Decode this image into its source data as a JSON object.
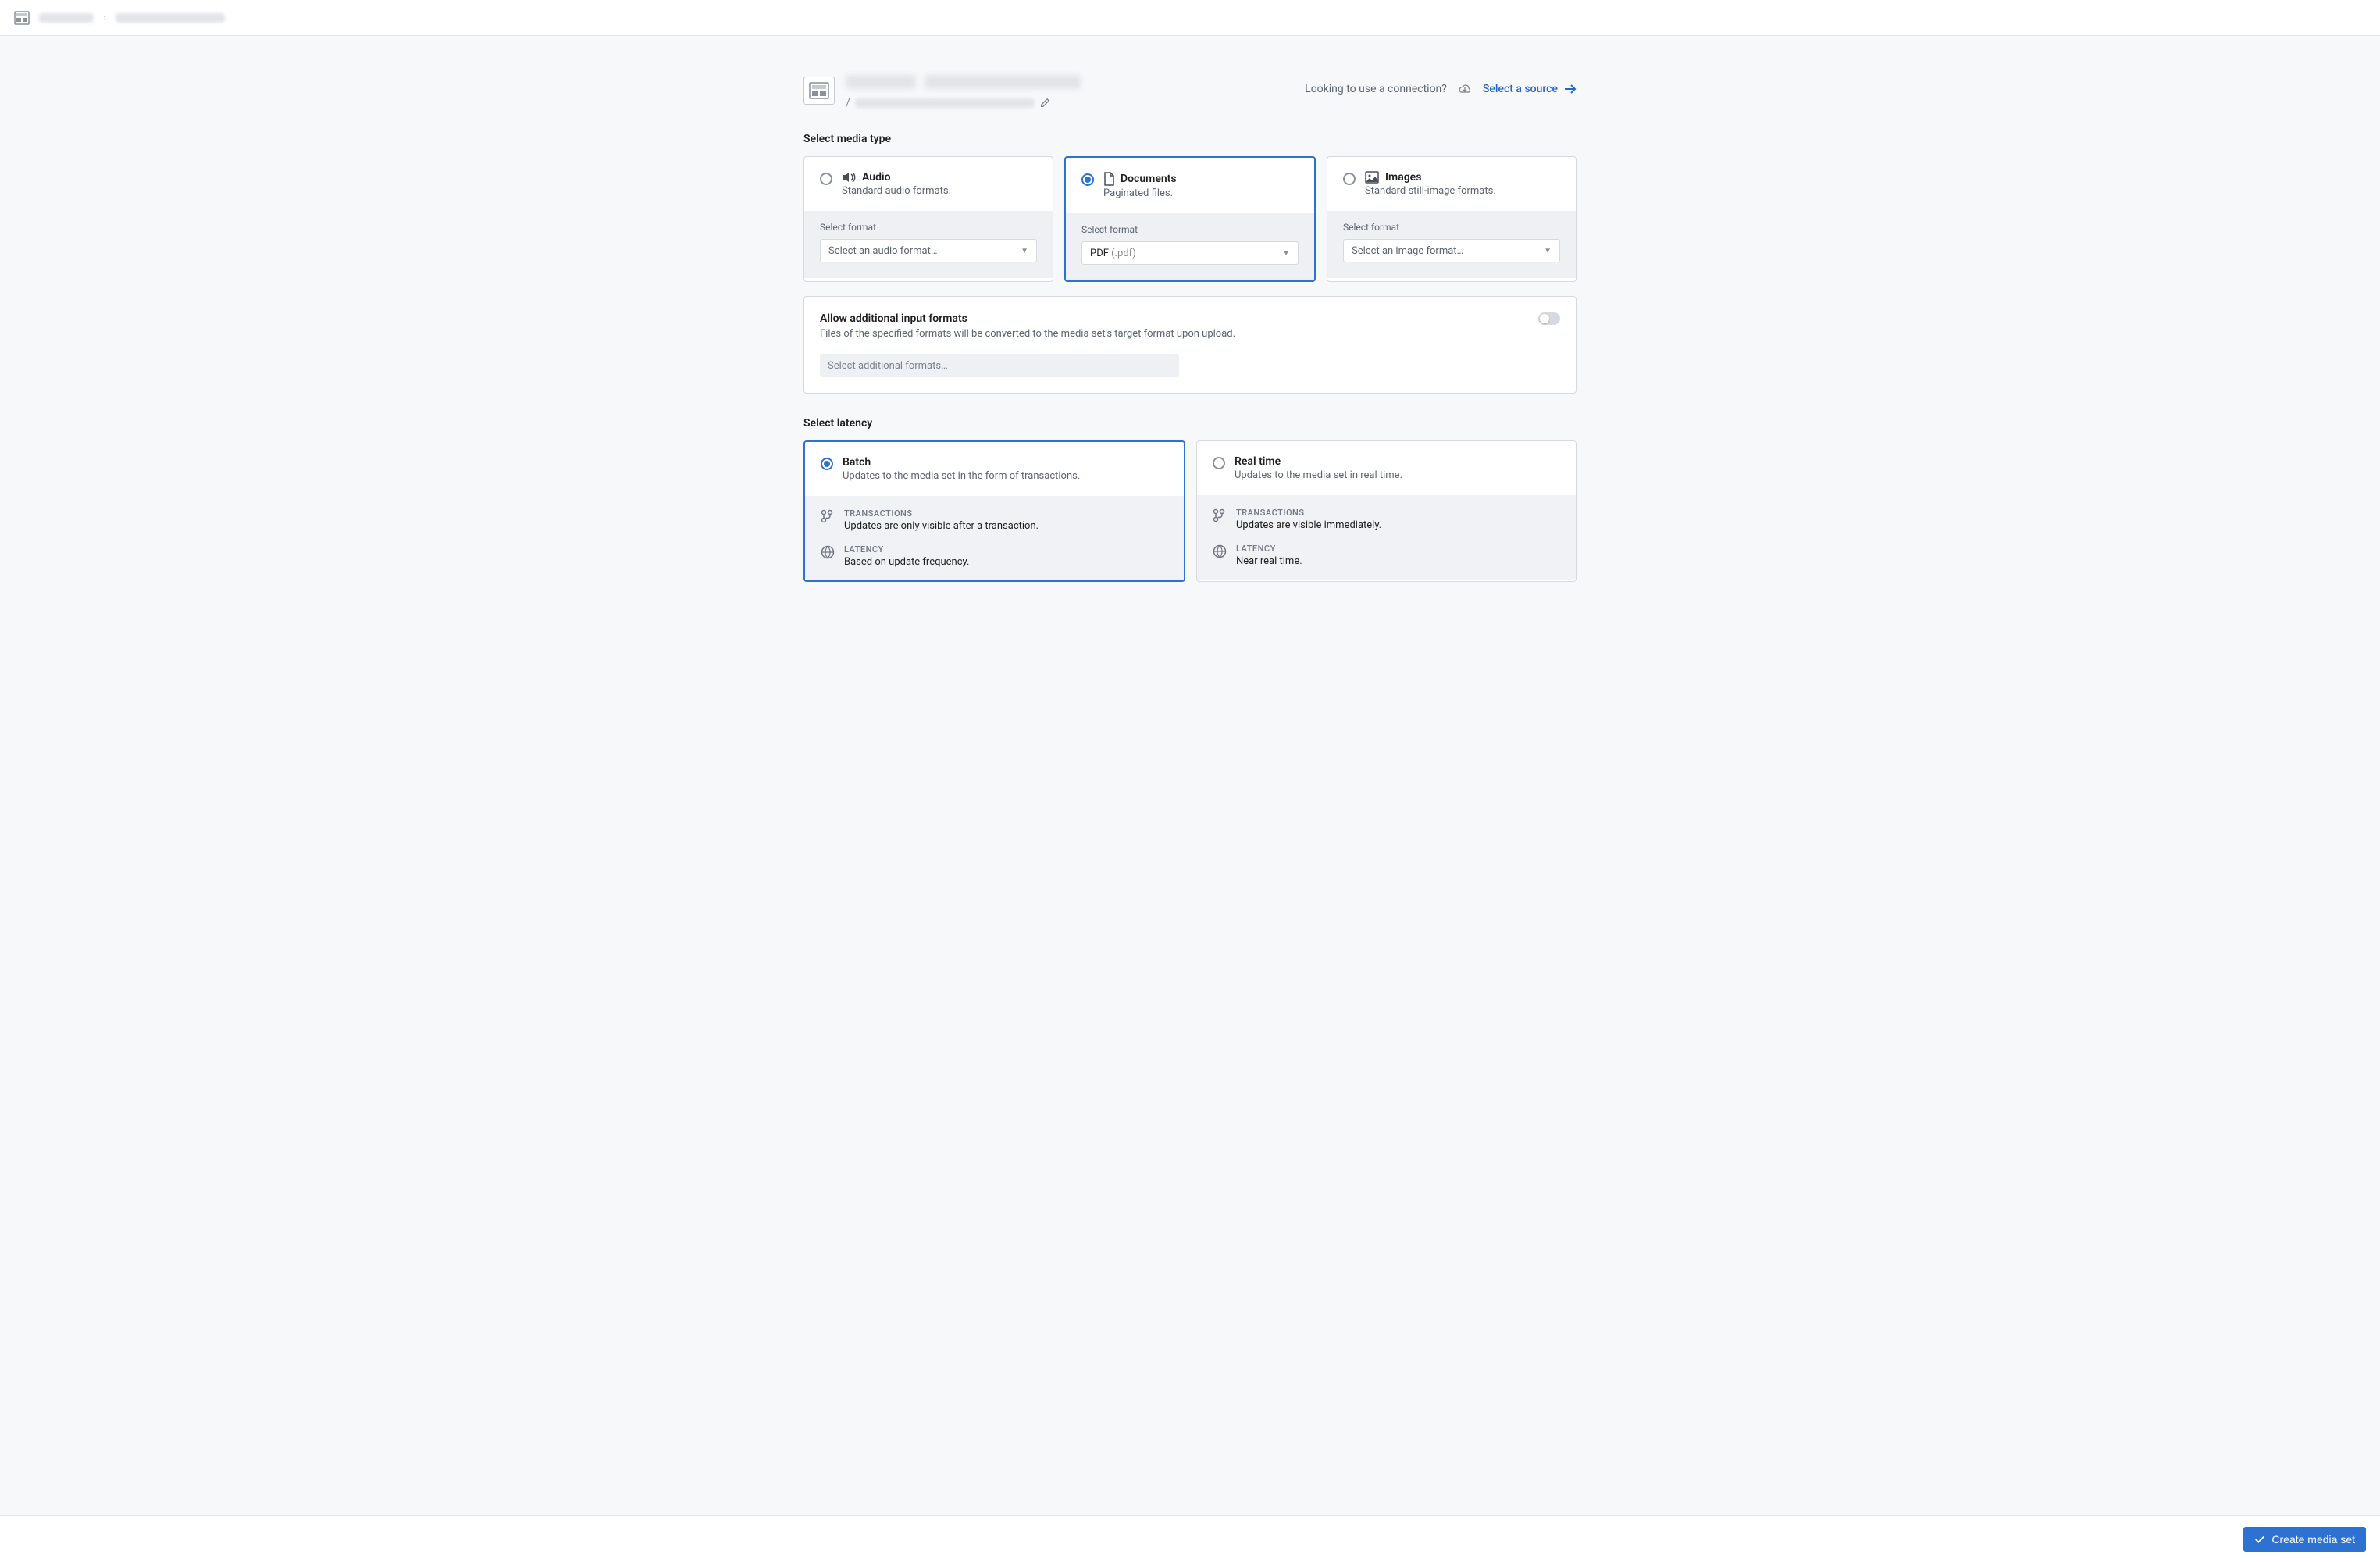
{
  "header": {
    "connection_prompt": "Looking to use a connection?",
    "select_source": "Select a source"
  },
  "sections": {
    "media_type_label": "Select media type",
    "latency_label": "Select latency"
  },
  "media_types": {
    "audio": {
      "title": "Audio",
      "desc": "Standard audio formats.",
      "format_label": "Select format",
      "format_placeholder": "Select an audio format…"
    },
    "documents": {
      "title": "Documents",
      "desc": "Paginated files.",
      "format_label": "Select format",
      "format_value": "PDF",
      "format_ext": "(.pdf)"
    },
    "images": {
      "title": "Images",
      "desc": "Standard still-image formats.",
      "format_label": "Select format",
      "format_placeholder": "Select an image format…"
    }
  },
  "additional_formats": {
    "title": "Allow additional input formats",
    "desc": "Files of the specified formats will be converted to the media set's target format upon upload.",
    "placeholder": "Select additional formats…"
  },
  "latency": {
    "batch": {
      "title": "Batch",
      "desc": "Updates to the media set in the form of transactions.",
      "transactions_label": "TRANSACTIONS",
      "transactions_text": "Updates are only visible after a transaction.",
      "latency_label": "LATENCY",
      "latency_text": "Based on update frequency."
    },
    "realtime": {
      "title": "Real time",
      "desc": "Updates to the media set in real time.",
      "transactions_label": "TRANSACTIONS",
      "transactions_text": "Updates are visible immediately.",
      "latency_label": "LATENCY",
      "latency_text": "Near real time."
    }
  },
  "footer": {
    "create_button": "Create media set"
  }
}
